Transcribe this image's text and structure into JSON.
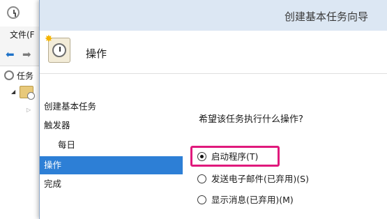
{
  "background_window": {
    "menu": {
      "file_label": "文件(F"
    },
    "tree": {
      "root_label": "任务"
    }
  },
  "dialog": {
    "title": "创建基本任务向导",
    "header_title": "操作",
    "steps": [
      {
        "label": "创建基本任务",
        "active": false
      },
      {
        "label": "触发器",
        "active": false
      },
      {
        "label": "每日",
        "active": false
      },
      {
        "label": "操作",
        "active": true
      },
      {
        "label": "完成",
        "active": false
      }
    ],
    "question": "希望该任务执行什么操作?",
    "options": [
      {
        "label": "启动程序(T)",
        "selected": true
      },
      {
        "label": "发送电子邮件(已弃用)(S)",
        "selected": false
      },
      {
        "label": "显示消息(已弃用)(M)",
        "selected": false
      }
    ],
    "highlight_color": "#e0197c",
    "active_step_color": "#2d7fd6"
  },
  "icons": [
    "clock-icon",
    "back-arrow-icon",
    "forward-arrow-icon",
    "task-library-icon",
    "wizard-task-icon"
  ]
}
